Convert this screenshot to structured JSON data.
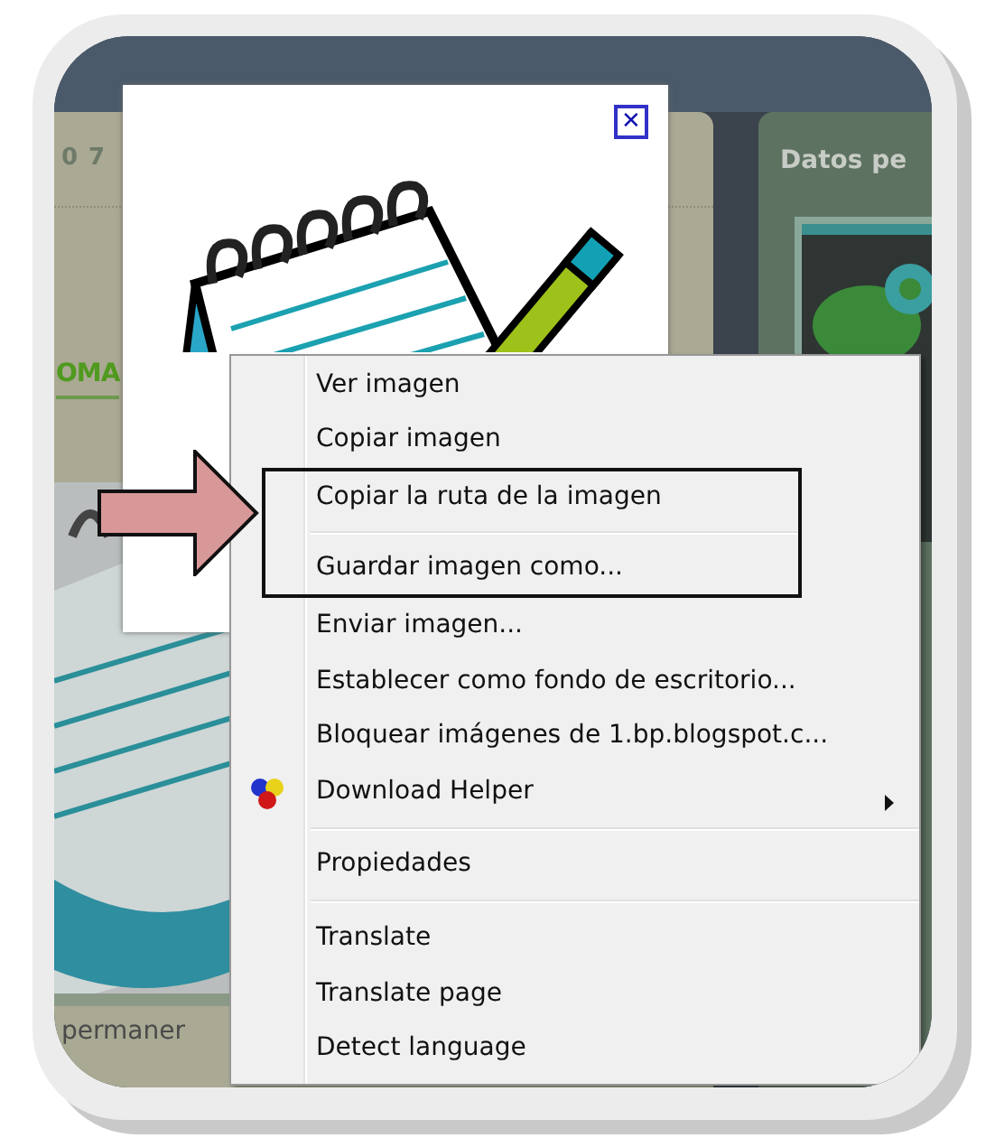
{
  "page": {
    "date_fragment": "07",
    "heading_fragment": "OMA",
    "sidebar_title": "Datos pe",
    "body_fragment": "permaner"
  },
  "image_popup": {
    "close_label": "✕"
  },
  "context_menu": {
    "items": [
      {
        "kind": "item",
        "label": "Ver imagen",
        "boxed": false,
        "submenu": false
      },
      {
        "kind": "item",
        "label": "Copiar imagen",
        "boxed": false,
        "submenu": false
      },
      {
        "kind": "item",
        "label": "Copiar la ruta de la imagen",
        "boxed": true,
        "submenu": false
      },
      {
        "kind": "separator"
      },
      {
        "kind": "item",
        "label": "Guardar imagen como...",
        "boxed": true,
        "submenu": false
      },
      {
        "kind": "item",
        "label": "Enviar imagen...",
        "boxed": false,
        "submenu": false
      },
      {
        "kind": "item",
        "label": "Establecer como fondo de escritorio...",
        "boxed": false,
        "submenu": false
      },
      {
        "kind": "item",
        "label": "Bloquear imágenes de 1.bp.blogspot.c...",
        "boxed": false,
        "submenu": false
      },
      {
        "kind": "extension",
        "label": "Download Helper",
        "boxed": false,
        "submenu": true
      },
      {
        "kind": "separator"
      },
      {
        "kind": "item",
        "label": "Propiedades",
        "boxed": false,
        "submenu": false
      },
      {
        "kind": "separator"
      },
      {
        "kind": "item",
        "label": "Translate",
        "boxed": false,
        "submenu": false
      },
      {
        "kind": "item",
        "label": "Translate page",
        "boxed": false,
        "submenu": false
      },
      {
        "kind": "item",
        "label": "Detect language",
        "boxed": false,
        "submenu": false
      }
    ]
  }
}
